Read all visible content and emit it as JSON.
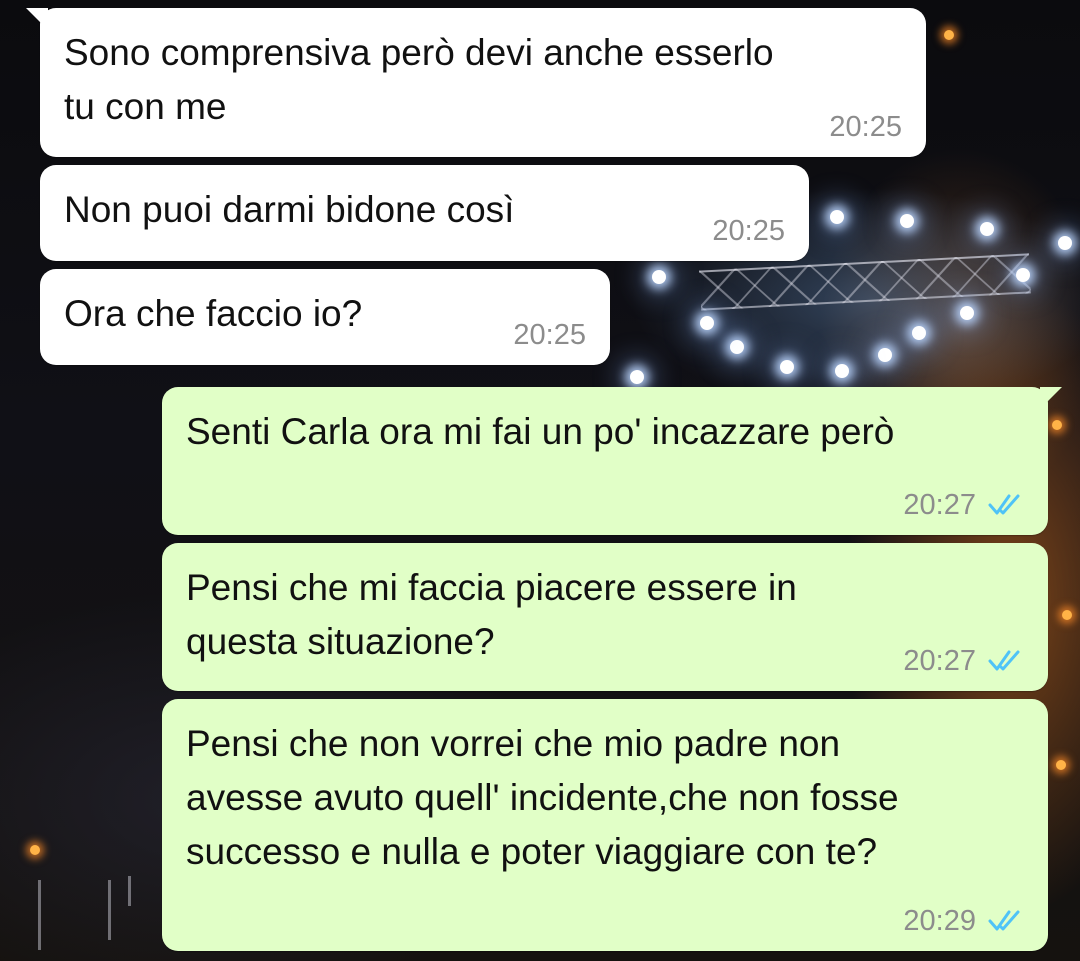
{
  "chat": {
    "messages": [
      {
        "direction": "incoming",
        "text_lines": [
          "Sono comprensiva però devi anche esserlo",
          "tu con me"
        ],
        "time": "20:25"
      },
      {
        "direction": "incoming",
        "text_lines": [
          "Non puoi darmi bidone così"
        ],
        "time": "20:25"
      },
      {
        "direction": "incoming",
        "text_lines": [
          "Ora che faccio io?"
        ],
        "time": "20:25"
      },
      {
        "direction": "outgoing",
        "text_lines": [
          "Senti Carla ora mi fai un po' incazzare però"
        ],
        "time": "20:27",
        "status_icon": "double-check-read-icon"
      },
      {
        "direction": "outgoing",
        "text_lines": [
          "Pensi che mi faccia piacere essere in",
          "questa situazione?"
        ],
        "time": "20:27",
        "status_icon": "double-check-read-icon"
      },
      {
        "direction": "outgoing",
        "text_lines": [
          "Pensi che non vorrei che mio padre non",
          "avesse avuto quell' incidente,che non fosse",
          "successo e nulla e poter viaggiare con te?"
        ],
        "time": "20:29",
        "status_icon": "double-check-read-icon"
      }
    ]
  },
  "colors": {
    "incoming_bubble": "#ffffff",
    "outgoing_bubble": "#e1ffc7",
    "read_ticks": "#4fc3f7",
    "timestamp": "#8c8c8c",
    "wallpaper": "#0d0d10"
  }
}
